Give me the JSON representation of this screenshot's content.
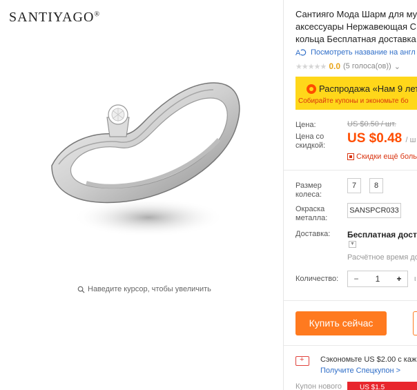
{
  "gallery": {
    "brand": "SANTIYAGO",
    "brand_mark": "®",
    "zoom_hint": "Наведите курсор, чтобы увеличить"
  },
  "product": {
    "title_lines": [
      "Сантияго Мода Шарм для му",
      "аксессуары Нержавеющая С",
      "кольца Бесплатная доставка"
    ],
    "translate_link": "Посмотреть название на англ",
    "rating_value": "0.0",
    "rating_count": "(5 голоса(ов))",
    "rating_chevron": "⌄"
  },
  "sale": {
    "main": "Распродажа «Нам 9 лет",
    "sub": "Собирайте купоны и экономьте бо"
  },
  "price": {
    "label": "Цена:",
    "old": "US $0.50 / шт.",
    "discount_label": "Цена со скидкой:",
    "new": "US $0.48",
    "new_unit": "/ ш",
    "discount_link": "Скидки ещё боль"
  },
  "options": {
    "size_label": "Размер колеса:",
    "sizes": [
      "7",
      "8"
    ],
    "color_label": "Окраска металла:",
    "color_value": "SANSPCR033",
    "shipping_label": "Доставка:",
    "shipping_value": "Бесплатная достав",
    "shipping_time": "Расчётное время до",
    "quantity_label": "Количество:",
    "quantity_value": "1",
    "quantity_minus": "−",
    "quantity_plus": "+",
    "quantity_extra": "ι"
  },
  "actions": {
    "buy_now": "Купить сейчас"
  },
  "coupon": {
    "save_text": "Сэкономьте US $2.00 с каж",
    "get_coupon": "Получите Спецкупон >",
    "new_coupon_label": "Купон нового",
    "red_coupon_text": "US $1.5"
  },
  "colors": {
    "accent_orange": "#ff7a1f",
    "price_red": "#ff4d00",
    "sale_yellow": "#ffd71a",
    "link_blue": "#2f6ec8"
  }
}
